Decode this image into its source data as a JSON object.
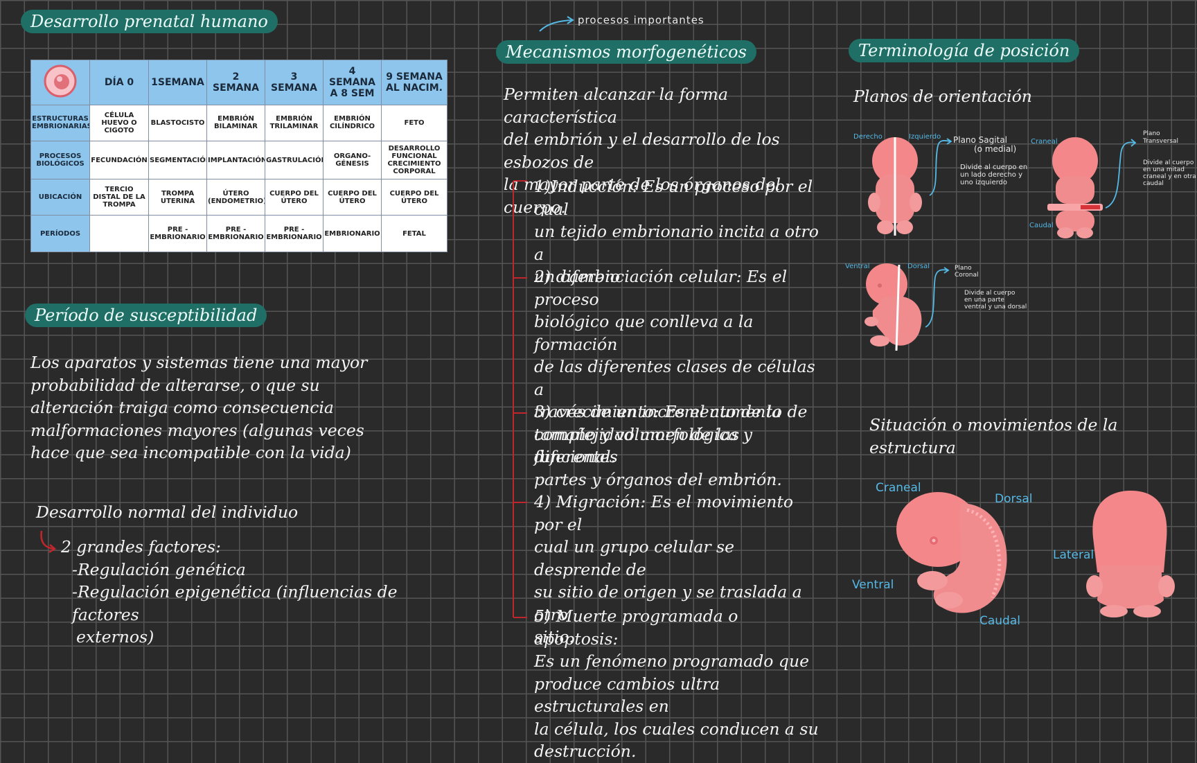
{
  "left": {
    "title": "Desarrollo prenatal humano",
    "table": {
      "headers": [
        "DÍA 0",
        "1SEMANA",
        "2 SEMANA",
        "3 SEMANA",
        "4 SEMANA A 8 SEM",
        "9 SEMANA AL NACIM."
      ],
      "rows": [
        {
          "label": "ESTRUCTURAS EMBRIONARIAS",
          "cells": [
            "CÉLULA HUEVO O CIGOTO",
            "BLASTOCISTO",
            "EMBRIÓN BILAMINAR",
            "EMBRIÓN TRILAMINAR",
            "EMBRIÓN CILÍNDRICO",
            "FETO"
          ]
        },
        {
          "label": "PROCESOS BIOLÓGICOS",
          "cells": [
            "FECUNDACIÓN",
            "SEGMENTACIÓN",
            "IMPLANTACIÓN",
            "GASTRULACIÓN",
            "ORGANO- GÉNESIS",
            "DESARROLLO FUNCIONAL CRECIMIENTO CORPORAL"
          ]
        },
        {
          "label": "UBICACIÓN",
          "cells": [
            "TERCIO DISTAL DE LA TROMPA",
            "TROMPA UTERINA",
            "ÚTERO (ENDOMETRIO)",
            "CUERPO DEL ÚTERO",
            "CUERPO DEL ÚTERO",
            "CUERPO DEL ÚTERO"
          ]
        },
        {
          "label": "PERÍODOS",
          "cells": [
            "",
            "PRE - EMBRIONARIO",
            "PRE - EMBRIONARIO",
            "PRE - EMBRIONARIO",
            "EMBRIONARIO",
            "FETAL"
          ]
        }
      ]
    },
    "susceptibility_title": "Período de susceptibilidad",
    "susceptibility_text": [
      "Los aparatos y sistemas tiene una mayor",
      "probabilidad de alterarse, o que su",
      "alteración traiga como consecuencia",
      "malformaciones mayores (algunas veces",
      "hace que sea incompatible con la vida)"
    ],
    "normal_dev": "Desarrollo normal del individuo",
    "factors": [
      "2 grandes factores:",
      "-Regulación genética",
      "-Regulación epigenética (influencias de factores",
      "externos)"
    ]
  },
  "middle": {
    "annotation": "procesos importantes",
    "title": "Mecanismos morfogenéticos",
    "intro": [
      "Permiten alcanzar la forma característica",
      "del embrión y el desarrollo de los esbozos de",
      "la mayor parte de los órganos del cuerpo."
    ],
    "items": [
      [
        "1)Inducción: Es un proceso por el cual",
        "un tejido embrionario incita a otro a",
        "un cambio"
      ],
      [
        "2) diferenciación celular: Es el proceso",
        "biológico que conlleva a la formación",
        "de las diferentes clases de células a",
        "través de un incremento de la",
        "complejidad morfológica y funcional."
      ],
      [
        "3) crecimiento: Es el aumento de",
        "tamaño y volumen de las diferentes",
        "partes y órganos del embrión."
      ],
      [
        "4) Migración: Es el movimiento por el",
        "cual un grupo celular se desprende de",
        "su sitio de origen y se traslada a otro",
        "sitio."
      ],
      [
        "5) Muerte programada o apoptosis:",
        "Es un fenómeno programado que",
        "produce cambios ultra estructurales en",
        "la célula, los cuales conducen a su",
        "destrucción."
      ]
    ]
  },
  "right": {
    "title": "Terminología de posición",
    "planes_title": "Planos de orientación",
    "sagittal": {
      "left": "Derecho",
      "right": "Izquierdo",
      "plane": [
        "Plano Sagital",
        "(o medial)"
      ],
      "desc": [
        "Divide al cuerpo en",
        "un lado derecho y",
        "uno izquierdo"
      ]
    },
    "transverse": {
      "top": "Craneal",
      "bottom": "Caudal",
      "plane": [
        "Plano",
        "Transversal"
      ],
      "desc": [
        "Divide al cuerpo",
        "en una mitad",
        "craneal y en otra",
        "caudal"
      ]
    },
    "coronal": {
      "left": "Ventral",
      "right": "Dorsal",
      "plane": [
        "Plano",
        "Coronal"
      ],
      "desc": [
        "Divide al cuerpo",
        "en una parte",
        "ventral y una dorsal"
      ]
    },
    "situation_title": "Situación o movimientos de la estructura",
    "directions": {
      "craneal": "Craneal",
      "dorsal": "Dorsal",
      "ventral": "Ventral",
      "caudal": "Caudal",
      "lateral": "Lateral"
    }
  },
  "colors": {
    "accent": "#1f6f66",
    "annotation": "#55b9e6",
    "embryo": "#f4878a",
    "bracket": "#c0262b"
  }
}
